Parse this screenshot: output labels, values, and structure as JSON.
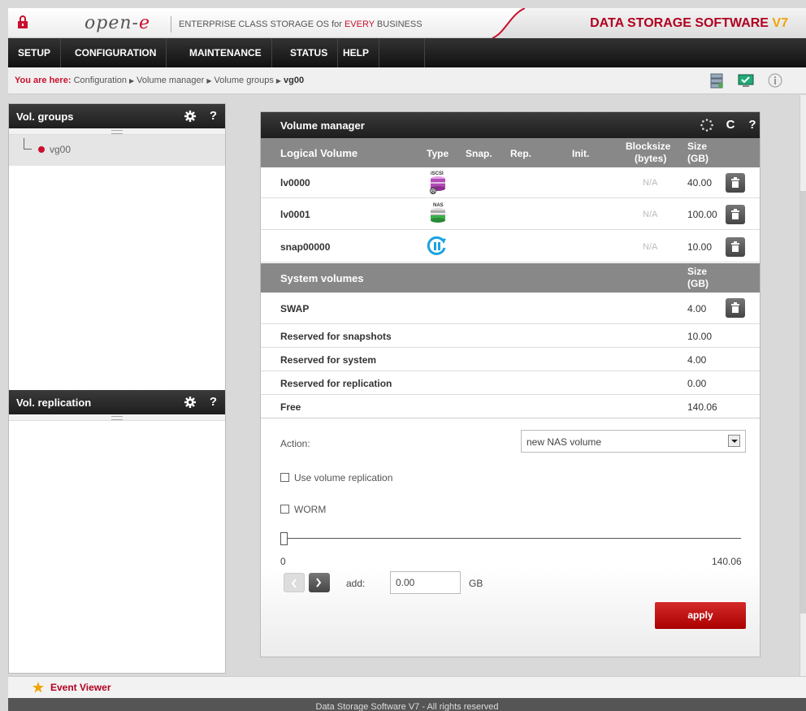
{
  "header": {
    "logo_main": "open-",
    "logo_e": "e",
    "tagline_prefix": "ENTERPRISE CLASS STORAGE OS for ",
    "tagline_red": "EVERY",
    "tagline_suffix": " BUSINESS",
    "brand_main": "DATA STORAGE SOFTWARE ",
    "brand_version": "V7"
  },
  "nav": {
    "items": [
      {
        "label": "SETUP"
      },
      {
        "label": "CONFIGURATION"
      },
      {
        "label": "MAINTENANCE"
      },
      {
        "label": "STATUS"
      },
      {
        "label": "HELP"
      }
    ]
  },
  "breadcrumb": {
    "label": "You are here:",
    "items": [
      "Configuration",
      "Volume manager",
      "Volume groups",
      "vg00"
    ]
  },
  "left": {
    "groups_title": "Vol. groups",
    "groups_help": "?",
    "tree_item": "vg00",
    "replication_title": "Vol. replication",
    "replication_help": "?"
  },
  "main": {
    "title": "Volume manager",
    "refresh_glyph": "C",
    "help": "?",
    "columns": {
      "name": "Logical Volume",
      "type": "Type",
      "snap": "Snap.",
      "rep": "Rep.",
      "init": "Init.",
      "blocksize": "Blocksize",
      "blocksize_unit": "(bytes)",
      "size": "Size",
      "size_unit": "(GB)"
    },
    "volumes": [
      {
        "name": "lv0000",
        "type_icon": "iscsi-volume-icon",
        "type_badge": "iSCSI",
        "blocksize": "N/A",
        "size": "40.00"
      },
      {
        "name": "lv0001",
        "type_icon": "nas-volume-icon",
        "type_badge": "NAS",
        "blocksize": "N/A",
        "size": "100.00"
      },
      {
        "name": "snap00000",
        "type_icon": "snapshot-icon",
        "blocksize": "N/A",
        "size": "10.00"
      }
    ],
    "system_header": "System volumes",
    "system_size": "Size",
    "system_size_unit": "(GB)",
    "system_rows": [
      {
        "name": "SWAP",
        "size": "4.00"
      },
      {
        "name": "Reserved for snapshots",
        "size": "10.00"
      },
      {
        "name": "Reserved for system",
        "size": "4.00"
      },
      {
        "name": "Reserved for replication",
        "size": "0.00"
      },
      {
        "name": "Free",
        "size": "140.06"
      }
    ],
    "action_label": "Action:",
    "action_value": "new NAS volume",
    "use_replication_label": "Use volume replication",
    "worm_label": "WORM",
    "slider": {
      "min": "0",
      "max": "140.06",
      "value_fraction": 0
    },
    "add_label": "add:",
    "add_value": "0.00",
    "unit": "GB",
    "apply_label": "apply"
  },
  "bottom": {
    "event_viewer": "Event Viewer",
    "footer": "Data Storage Software V7 - All rights reserved"
  },
  "colors": {
    "accent_red": "#c8102e",
    "brand_orange": "#f0a400",
    "header_dark": "#1e1e1e",
    "table_header_gray": "#888888"
  }
}
